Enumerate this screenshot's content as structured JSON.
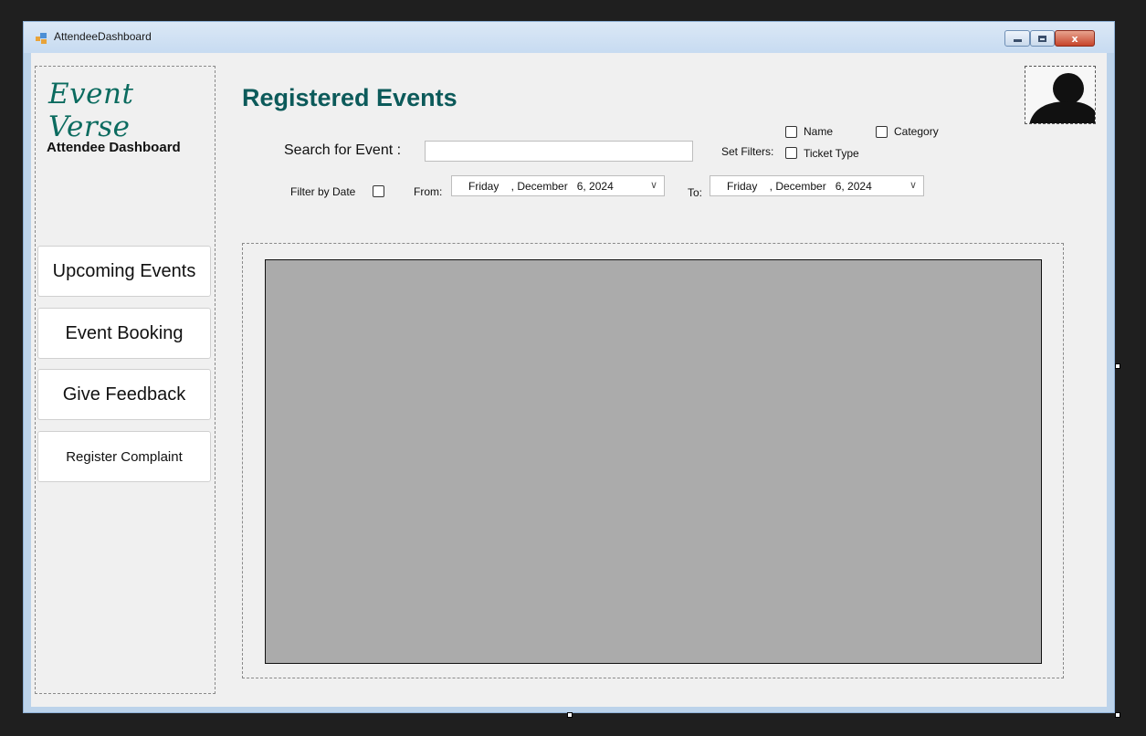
{
  "window": {
    "title": "AttendeeDashboard",
    "close_glyph": "x"
  },
  "sidebar": {
    "brand": "Event Verse",
    "subtitle": "Attendee Dashboard",
    "items": [
      {
        "label": "Upcoming Events"
      },
      {
        "label": "Event Booking"
      },
      {
        "label": "Give Feedback"
      },
      {
        "label": "Register Complaint"
      }
    ]
  },
  "main": {
    "title": "Registered Events",
    "search": {
      "label": "Search for Event :",
      "value": ""
    },
    "filters": {
      "label": "Set Filters:",
      "options": [
        {
          "label": "Name",
          "checked": false
        },
        {
          "label": "Category",
          "checked": false
        },
        {
          "label": "Ticket Type",
          "checked": false
        }
      ]
    },
    "date_filter": {
      "label": "Filter by Date",
      "checked": false,
      "from_label": "From:",
      "from_value": "Friday    , December   6, 2024",
      "to_label": "To:",
      "to_value": "Friday    , December   6, 2024",
      "arrow_glyph": "∨"
    }
  },
  "colors": {
    "brand": "#0b6b5f",
    "title": "#0c5a5a",
    "grid": "#ababab"
  }
}
